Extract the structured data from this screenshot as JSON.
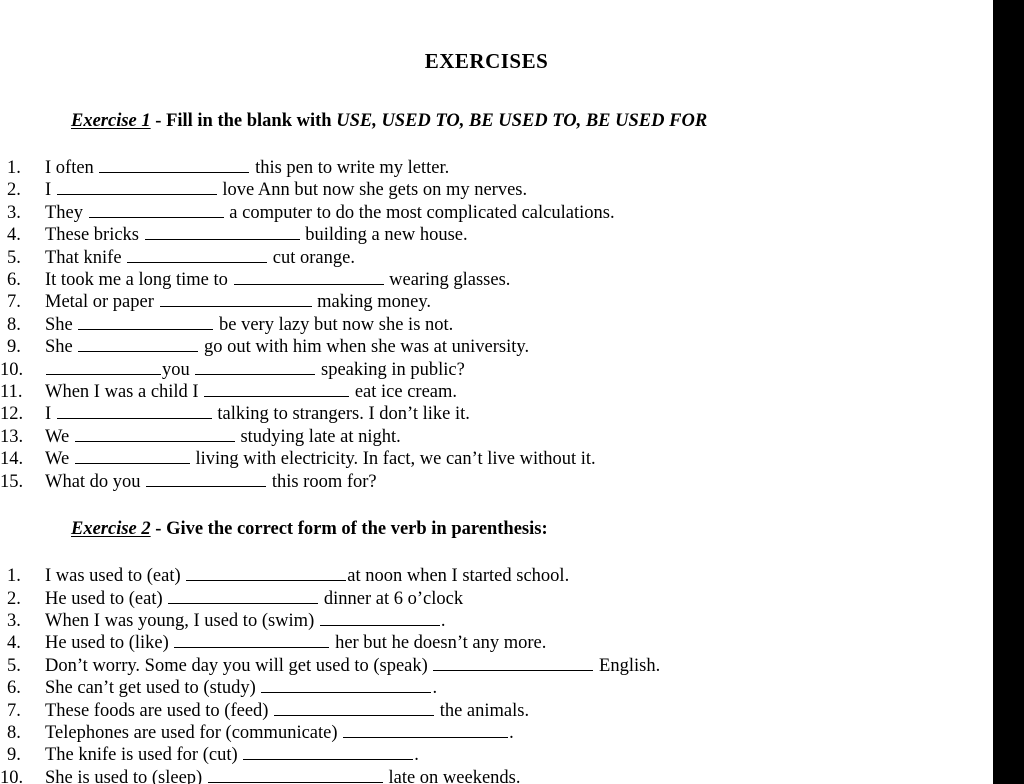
{
  "document": {
    "title": "EXERCISES",
    "exercise1": {
      "label": "Exercise 1",
      "dash": " - ",
      "instruction_plain": "Fill in the blank with ",
      "instruction_forms": "USE, USED TO, BE USED TO, BE USED FOR",
      "items": [
        {
          "num": "1.",
          "pre": "I often ",
          "blank1": 150,
          "mid": "",
          "blank2": 0,
          "post": " this pen to write my letter."
        },
        {
          "num": "2.",
          "pre": "I ",
          "blank1": 160,
          "mid": "",
          "blank2": 0,
          "post": " love Ann but now she gets on my nerves."
        },
        {
          "num": "3.",
          "pre": "They ",
          "blank1": 135,
          "mid": "",
          "blank2": 0,
          "post": " a computer to do the most complicated calculations."
        },
        {
          "num": "4.",
          "pre": "These bricks ",
          "blank1": 155,
          "mid": "",
          "blank2": 0,
          "post": " building a new house."
        },
        {
          "num": "5.",
          "pre": "That knife ",
          "blank1": 140,
          "mid": "",
          "blank2": 0,
          "post": " cut orange."
        },
        {
          "num": "6.",
          "pre": "It took me a long time to ",
          "blank1": 150,
          "mid": "",
          "blank2": 0,
          "post": " wearing glasses."
        },
        {
          "num": "7.",
          "pre": "Metal or paper ",
          "blank1": 152,
          "mid": "",
          "blank2": 0,
          "post": " making money."
        },
        {
          "num": "8.",
          "pre": "She ",
          "blank1": 135,
          "mid": "",
          "blank2": 0,
          "post": " be very lazy but now she is not."
        },
        {
          "num": "9.",
          "pre": "She ",
          "blank1": 120,
          "mid": "",
          "blank2": 0,
          "post": " go out with him when she was at university."
        },
        {
          "num": "10.",
          "pre": "",
          "blank1": 115,
          "mid": "you ",
          "blank2": 120,
          "post": " speaking in public?"
        },
        {
          "num": "11.",
          "pre": "When I was a child I ",
          "blank1": 145,
          "mid": "",
          "blank2": 0,
          "post": " eat ice cream."
        },
        {
          "num": "12.",
          "pre": "I ",
          "blank1": 155,
          "mid": "",
          "blank2": 0,
          "post": " talking to strangers. I don’t like it."
        },
        {
          "num": "13.",
          "pre": "We ",
          "blank1": 160,
          "mid": "",
          "blank2": 0,
          "post": " studying late at night."
        },
        {
          "num": "14.",
          "pre": "We ",
          "blank1": 115,
          "mid": "",
          "blank2": 0,
          "post": " living with electricity. In fact, we can’t live without it."
        },
        {
          "num": "15.",
          "pre": "What do you ",
          "blank1": 120,
          "mid": "",
          "blank2": 0,
          "post": " this room for?"
        }
      ]
    },
    "exercise2": {
      "label": "Exercise 2",
      "dash": " - ",
      "instruction_plain": "Give the correct form of the verb in parenthesis:",
      "items": [
        {
          "num": "1.",
          "pre": "I was used to (eat) ",
          "blank1": 160,
          "post": "at noon when I started school."
        },
        {
          "num": "2.",
          "pre": "He used to (eat) ",
          "blank1": 150,
          "post": " dinner at 6 o’clock"
        },
        {
          "num": "3.",
          "pre": "When I was young, I used to (swim) ",
          "blank1": 120,
          "post": "."
        },
        {
          "num": "4.",
          "pre": "He used to (like) ",
          "blank1": 155,
          "post": " her  but he doesn’t any more."
        },
        {
          "num": "5.",
          "pre": "Don’t worry. Some day you will get used to (speak) ",
          "blank1": 160,
          "post": " English."
        },
        {
          "num": "6.",
          "pre": "She can’t get used to (study) ",
          "blank1": 170,
          "post": "."
        },
        {
          "num": "7.",
          "pre": "These foods are used to (feed) ",
          "blank1": 160,
          "post": " the animals."
        },
        {
          "num": "8.",
          "pre": "Telephones are used for (communicate) ",
          "blank1": 165,
          "post": "."
        },
        {
          "num": "9.",
          "pre": "The knife is used for (cut) ",
          "blank1": 170,
          "post": "."
        },
        {
          "num": "10.",
          "pre": "She is used to (sleep) ",
          "blank1": 175,
          "post": " late on weekends."
        }
      ]
    }
  },
  "colors": {
    "page_background": "#ffffff",
    "text": "#000000",
    "edge_band": "#000000"
  }
}
